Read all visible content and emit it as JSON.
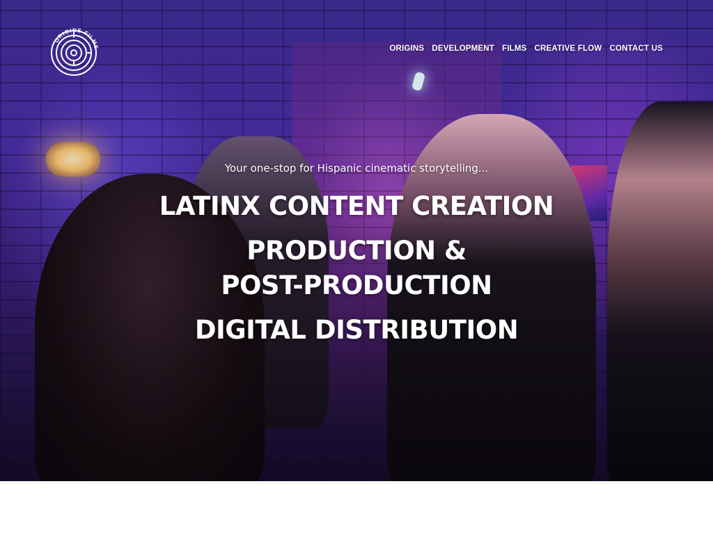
{
  "brand": {
    "logo_text": "ORIGINS FILMS",
    "logo_icon": "spiral-maze-icon"
  },
  "nav": {
    "items": [
      {
        "label": "ORIGINS"
      },
      {
        "label": "DEVELOPMENT"
      },
      {
        "label": "FILMS"
      },
      {
        "label": "CREATIVE FLOW"
      },
      {
        "label": "CONTACT US"
      }
    ]
  },
  "hero": {
    "tagline": "Your one-stop for Hispanic cinematic storytelling...",
    "headline_1": "LATINX CONTENT CREATION",
    "headline_2_line_1": "PRODUCTION &",
    "headline_2_line_2": "POST-PRODUCTION",
    "headline_3": "DIGITAL DISTRIBUTION"
  },
  "colors": {
    "text": "#ffffff",
    "hero_tint": "#4b2fa8",
    "page_bg": "#ffffff"
  }
}
